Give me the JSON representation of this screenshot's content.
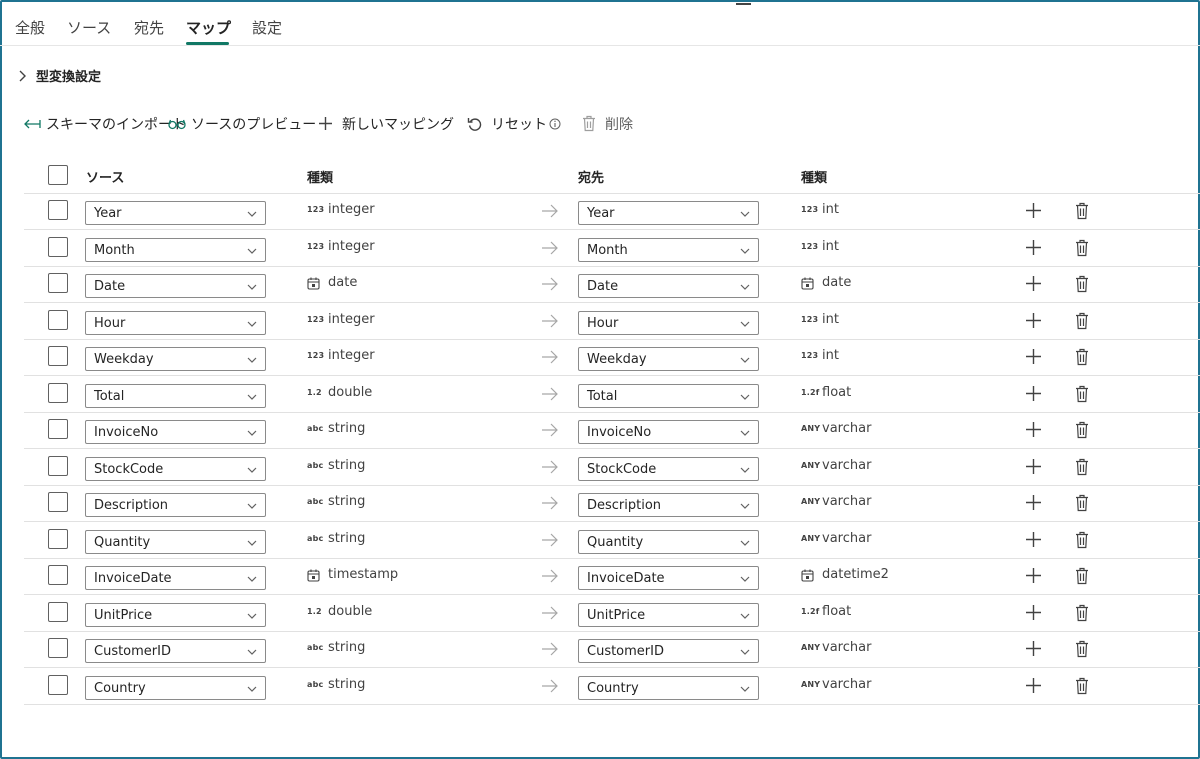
{
  "tabs": [
    "全般",
    "ソース",
    "宛先",
    "マップ",
    "設定"
  ],
  "active_tab": "マップ",
  "type_conversion": {
    "label": "型変換設定"
  },
  "toolbar": {
    "import_schema": "スキーマのインポート",
    "preview_source": "ソースのプレビュー",
    "new_mapping": "新しいマッピング",
    "reset": "リセット",
    "delete": "削除"
  },
  "columns": {
    "source": "ソース",
    "source_type": "種類",
    "destination": "宛先",
    "destination_type": "種類"
  },
  "type_tags": {
    "number": "123",
    "decimal": "1.2",
    "float": "1.2f",
    "text": "abc",
    "any": "ANY"
  },
  "rows": [
    {
      "source": "Year",
      "source_type": "integer",
      "source_icon": "number",
      "destination": "Year",
      "destination_type": "int",
      "destination_icon": "number"
    },
    {
      "source": "Month",
      "source_type": "integer",
      "source_icon": "number",
      "destination": "Month",
      "destination_type": "int",
      "destination_icon": "number"
    },
    {
      "source": "Date",
      "source_type": "date",
      "source_icon": "calendar",
      "destination": "Date",
      "destination_type": "date",
      "destination_icon": "calendar"
    },
    {
      "source": "Hour",
      "source_type": "integer",
      "source_icon": "number",
      "destination": "Hour",
      "destination_type": "int",
      "destination_icon": "number"
    },
    {
      "source": "Weekday",
      "source_type": "integer",
      "source_icon": "number",
      "destination": "Weekday",
      "destination_type": "int",
      "destination_icon": "number"
    },
    {
      "source": "Total",
      "source_type": "double",
      "source_icon": "decimal",
      "destination": "Total",
      "destination_type": "float",
      "destination_icon": "float"
    },
    {
      "source": "InvoiceNo",
      "source_type": "string",
      "source_icon": "text",
      "destination": "InvoiceNo",
      "destination_type": "varchar",
      "destination_icon": "any"
    },
    {
      "source": "StockCode",
      "source_type": "string",
      "source_icon": "text",
      "destination": "StockCode",
      "destination_type": "varchar",
      "destination_icon": "any"
    },
    {
      "source": "Description",
      "source_type": "string",
      "source_icon": "text",
      "destination": "Description",
      "destination_type": "varchar",
      "destination_icon": "any"
    },
    {
      "source": "Quantity",
      "source_type": "string",
      "source_icon": "text",
      "destination": "Quantity",
      "destination_type": "varchar",
      "destination_icon": "any"
    },
    {
      "source": "InvoiceDate",
      "source_type": "timestamp",
      "source_icon": "calendar",
      "destination": "InvoiceDate",
      "destination_type": "datetime2",
      "destination_icon": "calendar"
    },
    {
      "source": "UnitPrice",
      "source_type": "double",
      "source_icon": "decimal",
      "destination": "UnitPrice",
      "destination_type": "float",
      "destination_icon": "float"
    },
    {
      "source": "CustomerID",
      "source_type": "string",
      "source_icon": "text",
      "destination": "CustomerID",
      "destination_type": "varchar",
      "destination_icon": "any"
    },
    {
      "source": "Country",
      "source_type": "string",
      "source_icon": "text",
      "destination": "Country",
      "destination_type": "varchar",
      "destination_icon": "any"
    }
  ],
  "colors": {
    "accent": "#117865",
    "frame": "#1f7391"
  }
}
